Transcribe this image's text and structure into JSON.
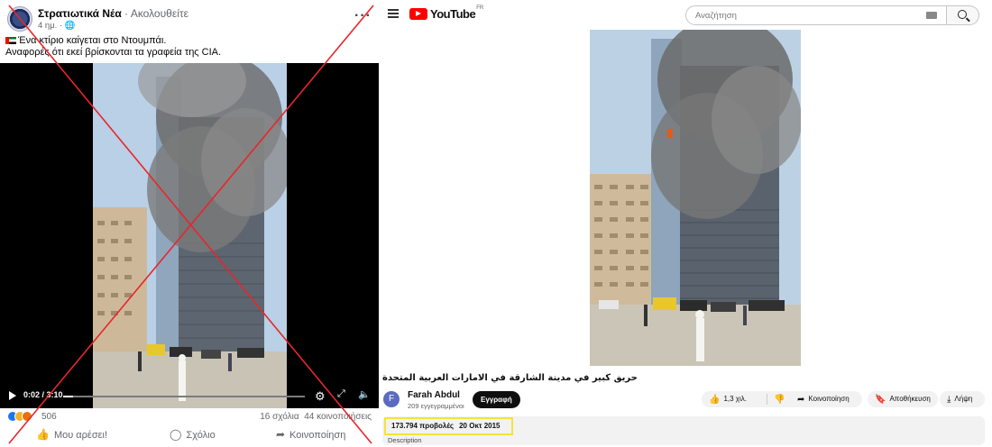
{
  "facebook": {
    "page_name": "Στρατιωτικά Νέα",
    "follow_label": "Ακολουθείτε",
    "time_ago": "4 ημ. · ",
    "globe_icon": "globe-icon",
    "more_icon": "more-icon",
    "post_line1": "Ένα κτίριο καίγεται στο Ντουμπάι.",
    "post_line2": "Αναφορές ότι εκεί βρίσκονται τα γραφεία της CIA.",
    "video": {
      "time": "0:02 / 3:10",
      "progress": 0.04,
      "icons": [
        "play-icon",
        "gear-icon",
        "expand-icon",
        "volume-icon"
      ]
    },
    "reactions_count": "506",
    "comments": "16 σχόλια",
    "shares": "44 κοινοποιήσεις",
    "actions": {
      "like": "Μου αρέσει!",
      "comment": "Σχόλιο",
      "share": "Κοινοποίηση"
    },
    "cross_color": "#e8262a"
  },
  "youtube": {
    "logo_text": "YouTube",
    "region": "FR",
    "search_placeholder": "Αναζήτηση",
    "video_title": "حريق كبير في مدينة الشارقة في الامارات العربية المتحدة",
    "channel": {
      "initial": "F",
      "name": "Farah Abdul",
      "subscribers": "209 εγγεγραμμένοι",
      "subscribe_label": "Εγγραφή"
    },
    "likes": "1,3 χιλ.",
    "share_label": "Κοινοποίηση",
    "save_label": "Αποθήκευση",
    "download_label": "Λήψη",
    "views": "173.794 προβολές",
    "date": "20 Οκτ 2015",
    "description_label": "Description",
    "highlight_color": "#f5e33a",
    "brand_color": "#ff0000"
  }
}
